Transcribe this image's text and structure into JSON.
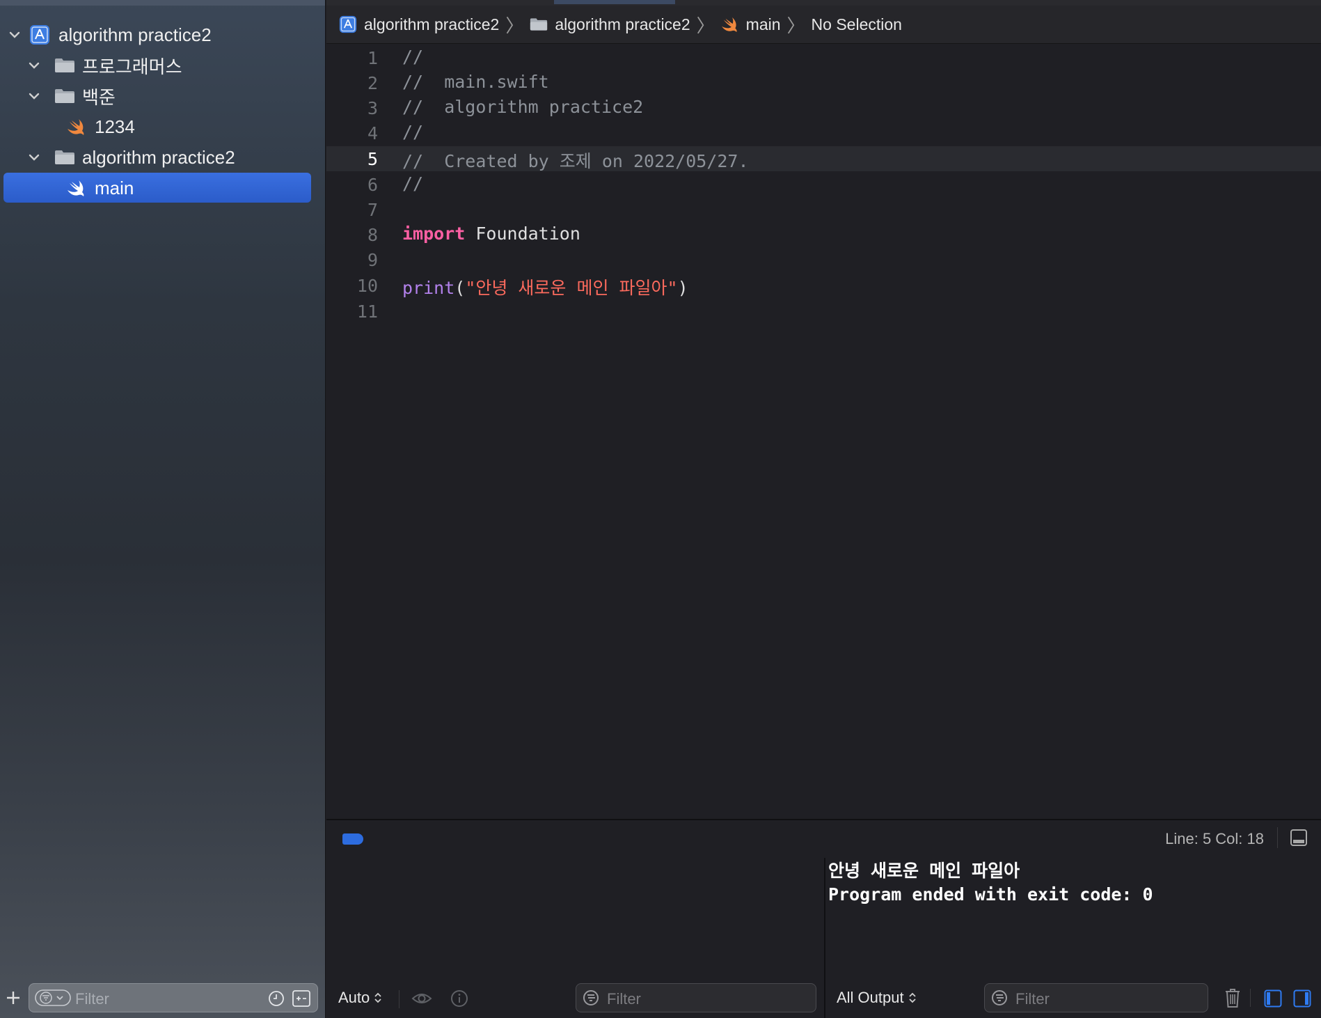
{
  "sidebar": {
    "project_name": "algorithm practice2",
    "items": [
      {
        "label": "프로그래머스"
      },
      {
        "label": "백준"
      },
      {
        "label": "1234"
      },
      {
        "label": "algorithm practice2"
      },
      {
        "label": "main"
      }
    ],
    "filter_placeholder": "Filter"
  },
  "jumpbar": {
    "crumbs": [
      "algorithm practice2",
      "algorithm practice2",
      "main",
      "No Selection"
    ]
  },
  "editor": {
    "lines": [
      {
        "num": "1",
        "text": "//"
      },
      {
        "num": "2",
        "text": "//  main.swift"
      },
      {
        "num": "3",
        "text": "//  algorithm practice2"
      },
      {
        "num": "4",
        "text": "//"
      },
      {
        "num": "5",
        "text": "//  Created by 조제 on 2022/05/27."
      },
      {
        "num": "6",
        "text": "//"
      },
      {
        "num": "7",
        "text": ""
      },
      {
        "num": "8",
        "keyword": "import",
        "rest": " Foundation"
      },
      {
        "num": "9",
        "text": ""
      },
      {
        "num": "10",
        "fn": "print",
        "open": "(",
        "str": "\"안녕 새로운 메인 파일아\"",
        "close": ")"
      },
      {
        "num": "11",
        "text": ""
      }
    ],
    "current_line": 5
  },
  "status": {
    "position": "Line: 5  Col: 18"
  },
  "variables_pane": {
    "scope": "Auto",
    "filter_placeholder": "Filter"
  },
  "console": {
    "output_line1": "안녕 새로운 메인 파일아",
    "output_line2": "Program ended with exit code: 0",
    "output_mode": "All Output",
    "filter_placeholder": "Filter"
  },
  "colors": {
    "accent": "#2f64d6",
    "keyword": "#fc5fa3",
    "string": "#fc6a5d",
    "function": "#b281eb",
    "comment": "#8d9299"
  }
}
